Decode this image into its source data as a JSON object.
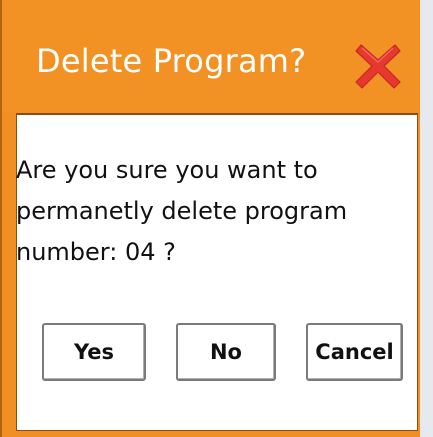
{
  "dialog": {
    "title": "Delete Program?",
    "close_icon": "close-x-icon",
    "message": "Are you sure you want to\npermanetly delete program\nnumber: 04 ?",
    "buttons": {
      "yes": "Yes",
      "no": "No",
      "cancel": "Cancel"
    }
  },
  "colors": {
    "titlebar": "#f29225",
    "close_icon": "#e8372e",
    "background": "#ffffff"
  }
}
